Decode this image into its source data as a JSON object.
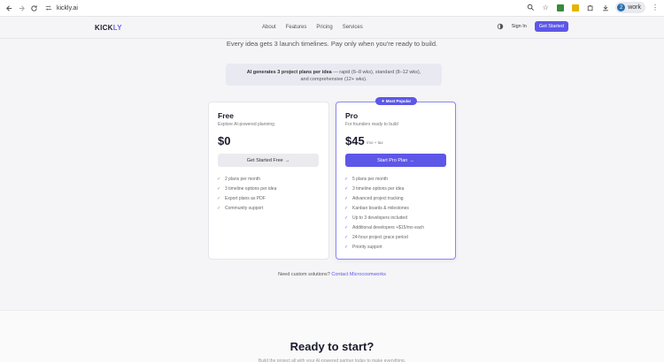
{
  "browser": {
    "url": "kickly.ai",
    "profile_label": "work",
    "profile_initial": "2"
  },
  "header": {
    "logo_part1": "KICK",
    "logo_part2": "LY",
    "nav": [
      "About",
      "Features",
      "Pricing",
      "Services"
    ],
    "signin": "Sign In",
    "cta": "Get Started"
  },
  "intro": {
    "subtitle": "Every idea gets 3 launch timelines. Pay only when you're ready to build.",
    "info_bold": "AI generates 3 project plans per idea",
    "info_rest": " — rapid (6–8 wks), standard (8–12 wks), and comprehensive (12+ wks)."
  },
  "plans": {
    "free": {
      "name": "Free",
      "desc": "Explore AI-powered planning",
      "price": "$0",
      "button": "Get Started Free",
      "features": [
        "2 plans per month",
        "3 timeline options per idea",
        "Export plans as PDF",
        "Community support"
      ]
    },
    "pro": {
      "badge": "Most Popular",
      "name": "Pro",
      "desc": "For founders ready to build",
      "price": "$45",
      "price_suffix": "/mo + tax",
      "button": "Start Pro Plan",
      "features": [
        "5 plans per month",
        "3 timeline options per idea",
        "Advanced project tracking",
        "Kanban boards & milestones",
        "Up to 3 developers included",
        "Additional developers +$15/mo each",
        "24-hour project grace period",
        "Priority support"
      ]
    }
  },
  "custom": {
    "text": "Need custom solutions? ",
    "link": "Contact Microcosmworks"
  },
  "ready": {
    "title": "Ready to start?",
    "subtitle": "Build the project all with your AI-powered partner today to make everything."
  },
  "colors": {
    "accent": "#5d57e8",
    "background": "#f5f5f7"
  }
}
